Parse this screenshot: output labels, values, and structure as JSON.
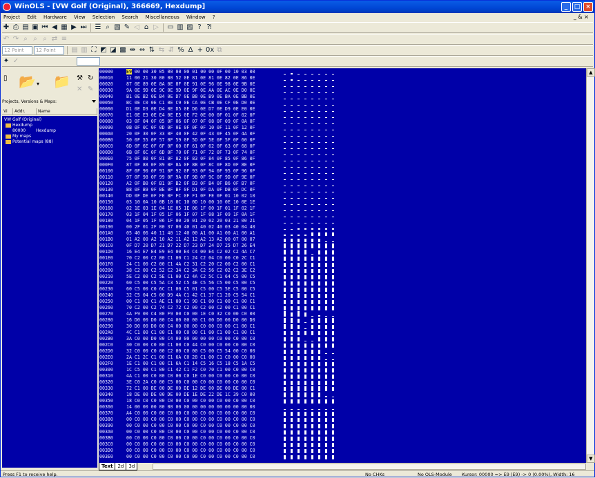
{
  "window": {
    "title": "WinOLS - [VW Golf (Original), 366669, Hexdump]"
  },
  "menu": [
    "Project",
    "Edit",
    "Hardware",
    "View",
    "Selection",
    "Search",
    "Miscellaneous",
    "Window",
    "?"
  ],
  "menu_mdi": "_ & ×",
  "toolbar": {
    "combo1": "12 Point",
    "combo2": "12 Point"
  },
  "left_panel": {
    "section": "Projects, Versions & Maps:",
    "columns": [
      "Vi",
      "Addr.",
      "Name"
    ],
    "tree": [
      {
        "text": "VW Golf (Original)",
        "addr": "",
        "name": ""
      },
      {
        "text": "Hexdump",
        "addr": "",
        "name": ""
      },
      {
        "text": "",
        "addr": "80000",
        "name": "Hexdump"
      },
      {
        "text": "My maps",
        "addr": "",
        "name": ""
      },
      {
        "text": "Potential maps (88)",
        "addr": "",
        "name": ""
      }
    ]
  },
  "hex": {
    "addresses": [
      "00000",
      "00010",
      "00020",
      "00030",
      "00040",
      "00050",
      "00060",
      "00070",
      "00080",
      "00090",
      "000A0",
      "000B0",
      "000C0",
      "000D0",
      "000E0",
      "000F0",
      "00100",
      "00110",
      "00120",
      "00130",
      "00140",
      "00150",
      "00160",
      "00170",
      "00180",
      "00190",
      "001A0",
      "001B0",
      "001C0",
      "001D0",
      "001E0",
      "001F0",
      "00200",
      "00210",
      "00220",
      "00230",
      "00240",
      "00250",
      "00260",
      "00270",
      "00280",
      "00290",
      "002A0",
      "002B0",
      "002C0",
      "002D0",
      "002E0",
      "002F0",
      "00300",
      "00310",
      "00320",
      "00330",
      "00340",
      "00350",
      "00360",
      "00370",
      "00380",
      "00390",
      "003A0",
      "003B0",
      "003C0",
      "003D0",
      "003E0"
    ],
    "rows": [
      "E9 00 00 30 05 00 00 00 01 00 00 0F 00 10 03 00",
      "11 00 21 30 00 00 52 0E 81 0E 81 0E 82 0E 86 0E",
      "87 0E 89 0E 8A 0E 8F 0E 91 0E 96 0E 98 0E 9B 0E",
      "9A 0E 9D 0E 9C 0E 9D 0E 9F 0E AA 0E AC 0E D0 0E",
      "B1 0E B2 0E B4 0E D7 0E B8 0E B9 0E BA 0E BB 0E",
      "BC 0E C0 0E C1 0E C9 0E CA 0E CB 0E CF 0E D0 0E",
      "D1 0E D3 0E D4 0E D5 0E D6 0E D7 0E D9 0E E0 0E",
      "E1 0E E3 0E E4 0E E5 0E F2 0E 00 0F 01 0F 02 0F",
      "03 0F 04 0F 05 0F 06 0F 07 0F 08 0F 09 0F 0A 0F",
      "0B 0F 0C 0F 0D 0F 0E 0F 0F 0F 10 0F 11 0F 12 0F",
      "20 0F 30 0F 33 0F 40 0F 42 0F 43 0F 45 0F 4A 0F",
      "50 0F 55 0F 57 0F 59 0F 5D 0F 5E 0F 5F 0F 60 0F",
      "6D 0F 6E 0F 6F 0F 60 0F 61 0F 62 0F 63 0F 68 0F",
      "6B 0F 6C 0F 6D 0F 70 0F 71 0F 72 0F 73 0F 74 0F",
      "75 0F 80 0F 81 0F 82 0F 83 0F 84 0F 85 0F 86 0F",
      "87 0F 88 0F 89 0F 8A 0F 8B 0F 8C 0F 8D 0F 8E 0F",
      "8F 0F 90 0F 91 0F 92 0F 93 0F 94 0F 95 0F 96 0F",
      "97 0F 98 0F 99 0F 9A 0F 9B 0F 9C 0F 9D 0F 9E 0F",
      "A2 0F B0 0F B1 0F B2 0F B3 0F B4 0F B6 0F B7 0F",
      "B8 0F B9 0F BE 0F BF 0F D1 0F DA 0F DB 0F DC 0F",
      "DD 0F DE 0F FE 0F FC 0F F1 0F FE 0F 01 10 02 10",
      "03 10 0A 10 0B 10 0C 10 0D 10 00 10 0E 10 0E 1E",
      "02 1E 03 1E 04 1E 05 1E 06 1F 00 1F 01 1F 02 1F",
      "03 1F 04 1F 05 1F 06 1F 07 1F 08 1F 09 1F 0A 1F",
      "04 1F 05 1F 06 1F 00 20 01 20 02 20 03 21 00 21",
      "00 2F 01 2F 00 37 00 40 01 40 02 40 03 40 04 40",
      "05 40 06 40 11 40 12 40 00 A1 00 A1 00 A1 00 A1",
      "01 A2 00 A2 10 A2 11 A2 12 A2 13 A2 00 07 00 07",
      "0F D7 20 D7 21 D7 22 D7 23 D7 24 D7 25 D7 26 E4",
      "16 E4 E7 E4 E9 E4 00 E4 C4 00 E4 C2 02 C2 4A C7",
      "70 C2 00 C2 00 C1 00 C1 24 C2 04 C0 00 C0 2C C1",
      "24 C1 00 C2 00 C1 4A C2 31 C2 20 C2 00 C2 00 C1",
      "38 C2 00 C2 52 C2 34 C2 3A C2 56 C2 02 C2 3E C2",
      "5E C2 00 C2 5E C1 00 C2 4A C2 5C C1 64 C5 00 C5",
      "60 C5 00 C5 5A C3 52 C5 4E C5 56 C5 00 C5 00 C5",
      "60 C5 00 C0 6C C1 00 C5 01 C5 00 C5 5E C5 00 C5",
      "32 C5 04 C5 00 D9 4A C1 42 C1 37 C1 20 C5 54 C1",
      "00 C1 00 C1 AE C1 00 C1 90 C1 00 C1 00 C1 00 C1",
      "70 C2 00 C2 74 C2 72 C2 00 C2 00 C2 00 C1 00 C1",
      "4A F9 00 C4 00 F9 00 C0 00 1E C0 32 C0 00 C0 00",
      "16 D0 00 D0 00 C4 00 00 00 C1 00 D0 00 D0 00 D0",
      "30 D0 00 D0 00 C4 00 00 00 C0 00 C0 00 C1 00 C1",
      "4C C1 00 C1 00 C1 00 C0 00 C1 00 C1 00 C1 00 C1",
      "3A C0 00 D0 00 C4 00 00 00 00 00 C0 00 C0 00 C0",
      "30 C0 00 C0 00 C1 00 C0 44 C0 00 C0 00 C0 00 C0",
      "32 C0 00 C0 00 C2 00 C0 00 C5 00 C5 54 00 C0 00",
      "2A C1 2C C1 00 C1 6A C0 28 C1 00 C1 C0 00 C0 00",
      "1E C1 00 C1 00 C1 6A C1 14 C5 16 C5 18 C5 1A C5",
      "1C C5 00 C1 00 C1 42 C1 F2 C0 70 C1 00 C0 00 C0",
      "4A C1 00 C0 00 C0 00 C0 1E C0 00 C0 00 C0 00 C0",
      "3E C0 2A C0 00 C5 00 C0 00 C0 00 C0 00 C0 00 C0",
      "72 C1 00 DE 00 DE 00 DE 12 DE 00 DE 00 DE 00 C1",
      "18 DE 00 DE 00 DE 00 DE 1E DE 22 DE 1C 39 C0 00",
      "18 C0 C0 C0 00 C0 00 C0 00 C0 00 C0 00 C0 00 C0",
      "14 00 00 00 00 00 00 00 00 00 00 00 00 00 00 00",
      "A4 C0 00 C0 00 C0 00 C0 00 C0 00 C0 00 C0 00 C0",
      "00 C0 00 C0 00 C0 00 C0 00 C0 00 C0 00 C0 00 C0",
      "00 C0 00 C0 00 C0 00 C0 00 C0 00 C0 00 C0 00 C0",
      "00 C0 00 C0 00 C0 00 C0 00 C0 00 C0 00 C0 00 C0",
      "00 C0 00 C0 00 C0 00 C0 00 C0 00 C0 00 C0 00 C0",
      "00 C0 00 C0 00 C0 00 C0 00 C0 00 C0 00 C0 00 C0",
      "00 C0 00 C0 00 C0 00 C0 00 C0 00 C0 00 C0 00 C0",
      "00 C0 00 C0 00 C0 00 C0 00 C0 00 C0 00 C0 00 C0"
    ]
  },
  "tabs": [
    "Text",
    "2d",
    "3d"
  ],
  "status": {
    "help": "Press F1 to receive help.",
    "chks": "No CHKs",
    "module": "No OLS-Module",
    "cursor": "Kursor: 00000 => E9 (E9) -> 0 (0.00%), Width: 16"
  },
  "colors": {
    "hex_bg": "#0000a8",
    "chrome": "#ece9d8",
    "title": "#0046d5"
  }
}
